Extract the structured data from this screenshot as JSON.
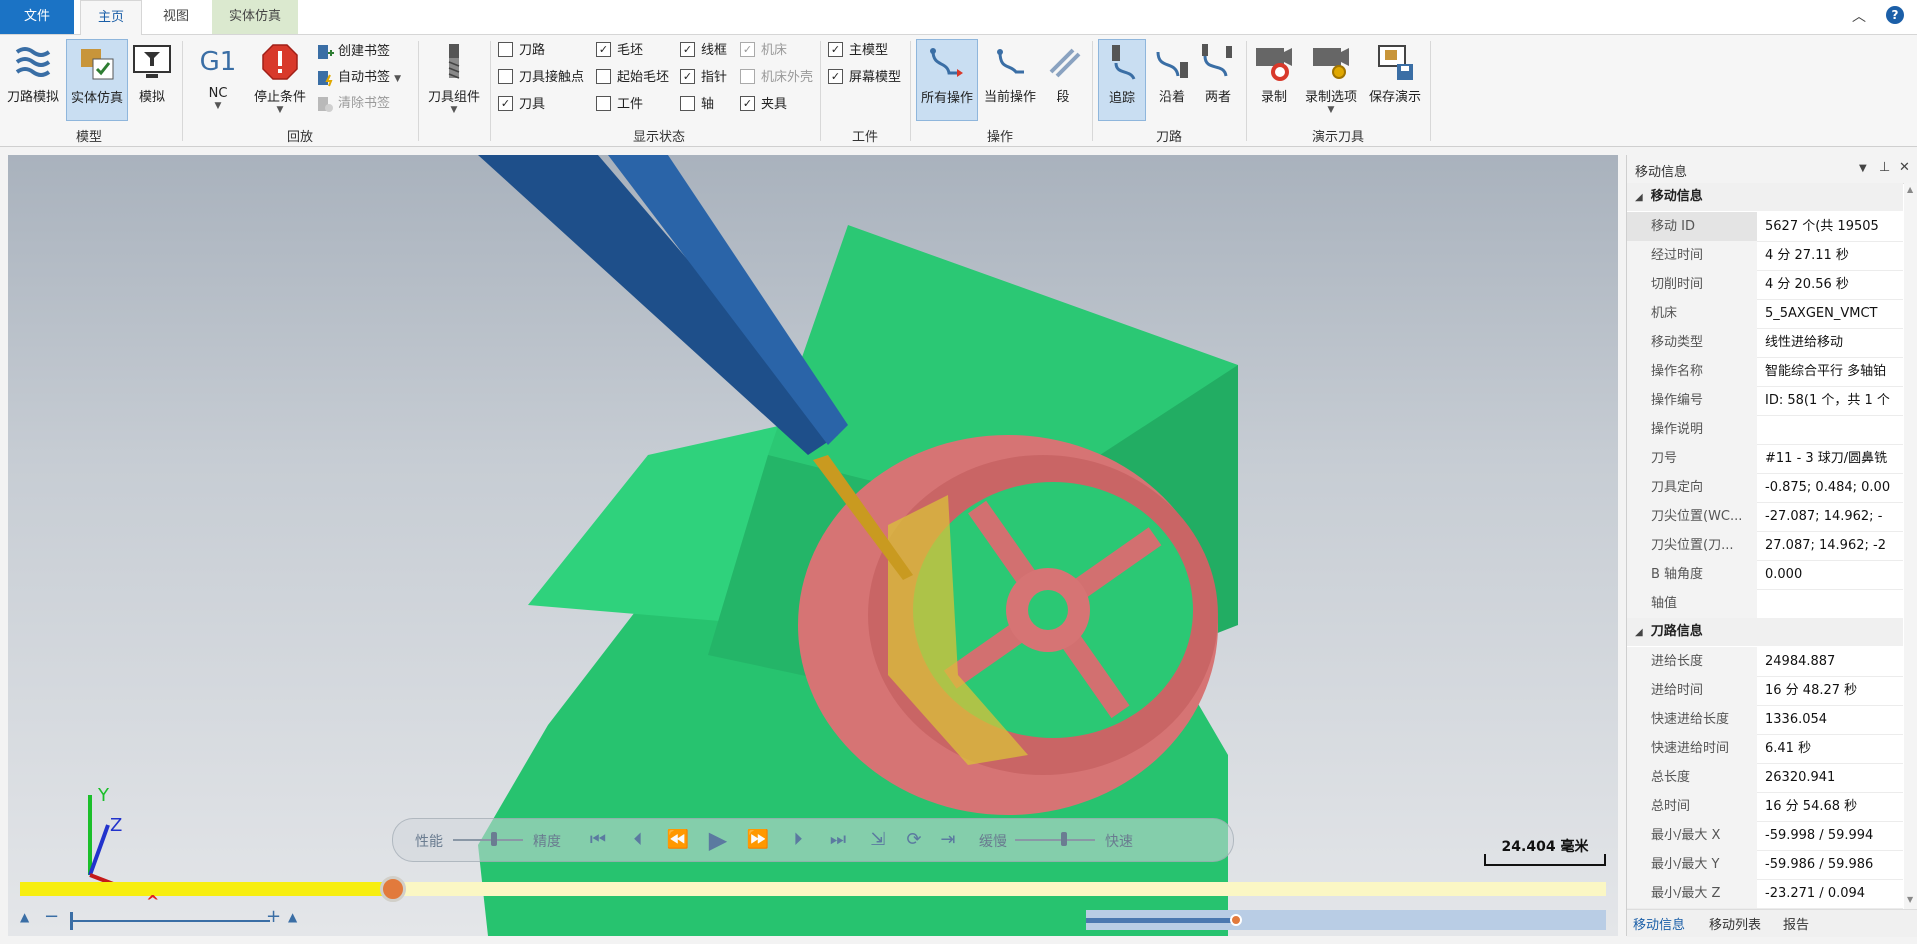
{
  "tabs": {
    "file": "文件",
    "home": "主页",
    "view": "视图",
    "sim": "实体仿真"
  },
  "ribbon": {
    "model": {
      "label": "模型",
      "toolpath_sim": "刀路模拟",
      "solid_sim": "实体仿真",
      "simulate": "模拟"
    },
    "playback": {
      "label": "回放",
      "nc_icon_text": "G1",
      "nc": "NC",
      "stop_condition": "停止条件",
      "create_bookmark": "创建书签",
      "auto_bookmark": "自动书签",
      "clear_bookmark": "清除书签"
    },
    "tool_assembly": "刀具组件",
    "display_state": {
      "label": "显示状态",
      "items": [
        {
          "label": "刀路",
          "checked": false
        },
        {
          "label": "刀具接触点",
          "checked": false
        },
        {
          "label": "刀具",
          "checked": true
        },
        {
          "label": "毛坯",
          "checked": true
        },
        {
          "label": "起始毛坯",
          "checked": false
        },
        {
          "label": "工件",
          "checked": false
        },
        {
          "label": "线框",
          "checked": true
        },
        {
          "label": "指针",
          "checked": true
        },
        {
          "label": "轴",
          "checked": false
        },
        {
          "label": "机床",
          "checked": true,
          "disabled": true
        },
        {
          "label": "机床外壳",
          "checked": false,
          "disabled": true
        },
        {
          "label": "夹具",
          "checked": true
        }
      ]
    },
    "workpiece": {
      "label": "工件",
      "main_model": "主模型",
      "screen_model": "屏幕模型"
    },
    "operation": {
      "label": "操作",
      "all_ops": "所有操作",
      "current_op": "当前操作",
      "segment": "段"
    },
    "toolpath": {
      "label": "刀路",
      "trace": "追踪",
      "along": "沿着",
      "both": "两者"
    },
    "demo": {
      "label": "演示刀具",
      "record": "录制",
      "record_options": "录制选项",
      "save_demo": "保存演示"
    }
  },
  "viewport": {
    "controls": {
      "performance": "性能",
      "precision": "精度",
      "slow": "缓慢",
      "fast": "快速"
    },
    "scale": "24.404 毫米",
    "axis_y": "Y",
    "axis_z": "Z",
    "progress_fraction": 0.235
  },
  "panel": {
    "title": "移动信息",
    "sections": [
      {
        "title": "移动信息",
        "rows": [
          {
            "name": "移动 ID",
            "value": "5627 个(共 19505"
          },
          {
            "name": "经过时间",
            "value": "4 分 27.11 秒"
          },
          {
            "name": "切削时间",
            "value": "4 分 20.56 秒"
          },
          {
            "name": "机床",
            "value": "5_5AXGEN_VMCT"
          },
          {
            "name": "移动类型",
            "value": "线性进给移动"
          },
          {
            "name": "操作名称",
            "value": "智能综合平行 多轴铂"
          },
          {
            "name": "操作编号",
            "value": "ID: 58(1 个，共 1 个"
          },
          {
            "name": "操作说明",
            "value": ""
          },
          {
            "name": "刀号",
            "value": "#11 - 3 球刀/圆鼻铣"
          },
          {
            "name": "刀具定向",
            "value": "-0.875; 0.484; 0.00"
          },
          {
            "name": "刀尖位置(WC...",
            "value": "-27.087; 14.962; -"
          },
          {
            "name": "刀尖位置(刀...",
            "value": "27.087; 14.962; -2"
          },
          {
            "name": "B 轴角度",
            "value": "0.000"
          },
          {
            "name": "轴值",
            "value": ""
          }
        ]
      },
      {
        "title": "刀路信息",
        "rows": [
          {
            "name": "进给长度",
            "value": "24984.887"
          },
          {
            "name": "进给时间",
            "value": "16 分 48.27 秒"
          },
          {
            "name": "快速进给长度",
            "value": "1336.054"
          },
          {
            "name": "快速进给时间",
            "value": "6.41 秒"
          },
          {
            "name": "总长度",
            "value": "26320.941"
          },
          {
            "name": "总时间",
            "value": "16 分 54.68 秒"
          },
          {
            "name": "最小/最大 X",
            "value": "-59.998 / 59.994"
          },
          {
            "name": "最小/最大 Y",
            "value": "-59.986 / 59.986"
          },
          {
            "name": "最小/最大 Z",
            "value": "-23.271 / 0.094"
          }
        ]
      }
    ],
    "tabs": {
      "move_info": "移动信息",
      "move_list": "移动列表",
      "report": "报告"
    }
  }
}
